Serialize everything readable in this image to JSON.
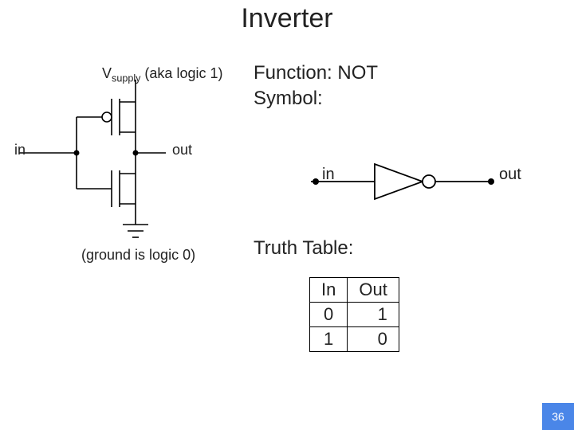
{
  "title": "Inverter",
  "supply_label_prefix": "V",
  "supply_label_sub": "supply",
  "supply_label_suffix": " (aka logic 1)",
  "function_line": "Function: NOT",
  "symbol_line": "Symbol:",
  "circuit_in_label": "in",
  "circuit_out_label": "out",
  "symbol_in_label": "in",
  "symbol_out_label": "out",
  "ground_note": "(ground is logic 0)",
  "truth_table_label": "Truth Table:",
  "truth_table": {
    "headers": [
      "In",
      "Out"
    ],
    "rows": [
      [
        "0",
        "1"
      ],
      [
        "1",
        "0"
      ]
    ]
  },
  "page_number": "36"
}
